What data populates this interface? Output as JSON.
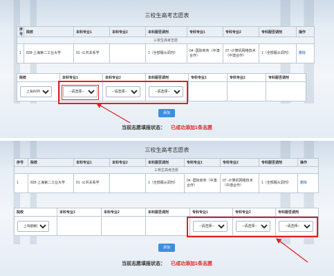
{
  "page_title": "三校生高考志愿表",
  "headers": {
    "seq": "序号",
    "school": "院校",
    "major1": "本科专业1",
    "major2": "本科专业2",
    "undergrad_adjust": "本科服否调剂",
    "college_major1": "专科专业1",
    "college_major2": "专科专业2",
    "college_adjust": "专科服否调剂",
    "operation": "操作"
  },
  "section_label": "三校生高考志愿",
  "row": {
    "seq": "1",
    "school": "828-上海第二工业大学",
    "major1": "01 -公共关系学",
    "major2": "",
    "undergrad_adjust": "1（全部服从调剂）",
    "college_major1": "04 -国际商务（中澳合作）",
    "college_major2": "07 -计算机网络技术（中澳合作）",
    "college_adjust": "1（全部服从调剂）",
    "delete": "删除"
  },
  "select_headers": {
    "school": "院校",
    "major1": "本科专业1",
    "major2": "本科专业2",
    "undergrad_adjust": "本科服否调剂",
    "college_major1": "专科专业1",
    "college_major2": "专科专业2",
    "college_adjust": "专科服否调剂"
  },
  "select_placeholder": "--请选择--",
  "panel1_school": "上海商学院",
  "panel2_school": "上海健康医学院",
  "add_label": "添加",
  "status_label": "当前志愿填报状态：",
  "status_value": "已成功添加1条志愿",
  "colors": {
    "accent": "#3b8fe0",
    "highlight": "#e02020",
    "link": "#1f5fb3"
  }
}
